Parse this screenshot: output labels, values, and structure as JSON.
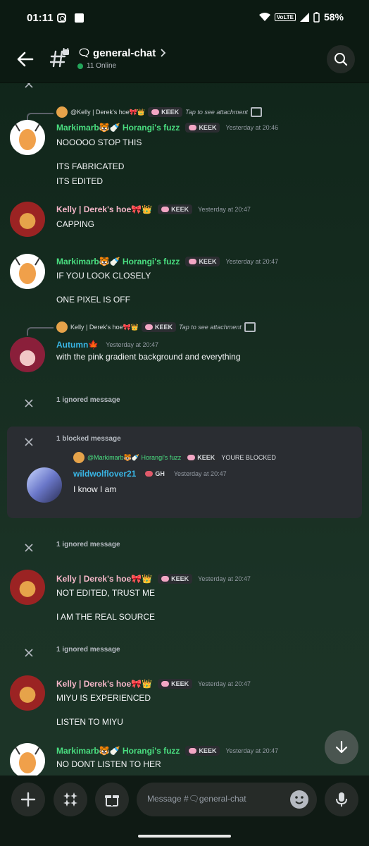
{
  "status_bar": {
    "time": "01:11",
    "battery": "58%",
    "network_label": "VoLTE"
  },
  "header": {
    "channel_name": "general-chat",
    "online_count": "11 Online"
  },
  "messages": [
    {
      "reply": {
        "author": "@Kelly | Derek's hoe🎀👑",
        "tag": "KEEK",
        "preview": "Tap to see attachment"
      },
      "author": "Markimarb🐯🍼 Horangi's fuzz",
      "tag": "KEEK",
      "timestamp": "Yesterday at 20:46",
      "lines": [
        "NOOOOO STOP THIS",
        "ITS FABRICATED",
        "ITS EDITED"
      ]
    },
    {
      "author": "Kelly | Derek's hoe🎀👑",
      "tag": "KEEK",
      "timestamp": "Yesterday at 20:47",
      "lines": [
        "CAPPING"
      ]
    },
    {
      "author": "Markimarb🐯🍼 Horangi's fuzz",
      "tag": "KEEK",
      "timestamp": "Yesterday at 20:47",
      "lines": [
        "IF YOU LOOK CLOSELY",
        "ONE PIXEL IS OFF"
      ]
    },
    {
      "reply": {
        "author": "Kelly | Derek's hoe🎀👑",
        "tag": "KEEK",
        "preview": "Tap to see attachment"
      },
      "author": "Autumn🍁",
      "timestamp": "Yesterday at 20:47",
      "lines": [
        "with the pink gradient background and everything"
      ]
    },
    {
      "ignored": "1 ignored message"
    },
    {
      "blocked_label": "1 blocked message",
      "reply": {
        "author": "@Markimarb🐯🍼 Horangi's fuzz",
        "tag": "KEEK",
        "preview": "YOURE BLOCKED"
      },
      "author": "wildwolflover21",
      "tag": "GH",
      "timestamp": "Yesterday at 20:47",
      "lines": [
        "I know I am"
      ]
    },
    {
      "ignored": "1 ignored message"
    },
    {
      "author": "Kelly | Derek's hoe🎀👑",
      "tag": "KEEK",
      "timestamp": "Yesterday at 20:47",
      "lines": [
        "NOT EDITED, TRUST ME",
        "I AM THE REAL SOURCE"
      ]
    },
    {
      "ignored": "1 ignored message"
    },
    {
      "author": "Kelly | Derek's hoe🎀👑",
      "tag": "KEEK",
      "timestamp": "Yesterday at 20:47",
      "lines": [
        "MIYU IS EXPERIENCED",
        "LISTEN TO MIYU"
      ]
    },
    {
      "author": "Markimarb🐯🍼 Horangi's fuzz",
      "tag": "KEEK",
      "timestamp": "Yesterday at 20:47",
      "lines": [
        "NO DONT LISTEN TO HER"
      ]
    }
  ],
  "composer": {
    "placeholder": "Message #🗨general-chat"
  },
  "colors": {
    "online": "#23a55a",
    "name_green": "#4ade80",
    "name_pink": "#f4b6c8",
    "name_cyan": "#39b6e6"
  }
}
